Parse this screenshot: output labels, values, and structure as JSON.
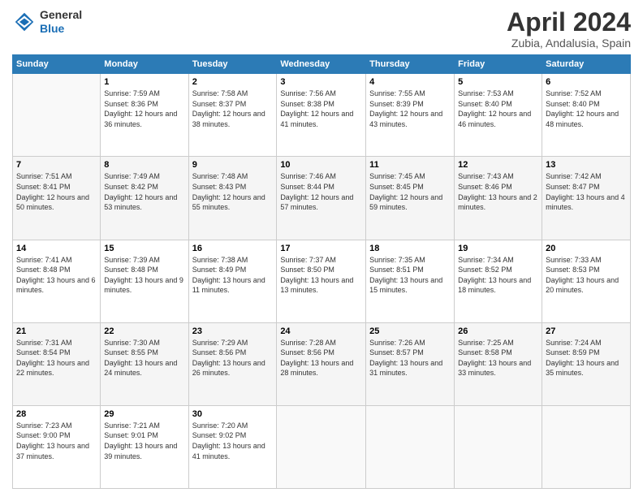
{
  "logo": {
    "line1": "General",
    "line2": "Blue"
  },
  "title": "April 2024",
  "subtitle": "Zubia, Andalusia, Spain",
  "days_header": [
    "Sunday",
    "Monday",
    "Tuesday",
    "Wednesday",
    "Thursday",
    "Friday",
    "Saturday"
  ],
  "weeks": [
    [
      {
        "day": "",
        "sunrise": "",
        "sunset": "",
        "daylight": ""
      },
      {
        "day": "1",
        "sunrise": "Sunrise: 7:59 AM",
        "sunset": "Sunset: 8:36 PM",
        "daylight": "Daylight: 12 hours and 36 minutes."
      },
      {
        "day": "2",
        "sunrise": "Sunrise: 7:58 AM",
        "sunset": "Sunset: 8:37 PM",
        "daylight": "Daylight: 12 hours and 38 minutes."
      },
      {
        "day": "3",
        "sunrise": "Sunrise: 7:56 AM",
        "sunset": "Sunset: 8:38 PM",
        "daylight": "Daylight: 12 hours and 41 minutes."
      },
      {
        "day": "4",
        "sunrise": "Sunrise: 7:55 AM",
        "sunset": "Sunset: 8:39 PM",
        "daylight": "Daylight: 12 hours and 43 minutes."
      },
      {
        "day": "5",
        "sunrise": "Sunrise: 7:53 AM",
        "sunset": "Sunset: 8:40 PM",
        "daylight": "Daylight: 12 hours and 46 minutes."
      },
      {
        "day": "6",
        "sunrise": "Sunrise: 7:52 AM",
        "sunset": "Sunset: 8:40 PM",
        "daylight": "Daylight: 12 hours and 48 minutes."
      }
    ],
    [
      {
        "day": "7",
        "sunrise": "Sunrise: 7:51 AM",
        "sunset": "Sunset: 8:41 PM",
        "daylight": "Daylight: 12 hours and 50 minutes."
      },
      {
        "day": "8",
        "sunrise": "Sunrise: 7:49 AM",
        "sunset": "Sunset: 8:42 PM",
        "daylight": "Daylight: 12 hours and 53 minutes."
      },
      {
        "day": "9",
        "sunrise": "Sunrise: 7:48 AM",
        "sunset": "Sunset: 8:43 PM",
        "daylight": "Daylight: 12 hours and 55 minutes."
      },
      {
        "day": "10",
        "sunrise": "Sunrise: 7:46 AM",
        "sunset": "Sunset: 8:44 PM",
        "daylight": "Daylight: 12 hours and 57 minutes."
      },
      {
        "day": "11",
        "sunrise": "Sunrise: 7:45 AM",
        "sunset": "Sunset: 8:45 PM",
        "daylight": "Daylight: 12 hours and 59 minutes."
      },
      {
        "day": "12",
        "sunrise": "Sunrise: 7:43 AM",
        "sunset": "Sunset: 8:46 PM",
        "daylight": "Daylight: 13 hours and 2 minutes."
      },
      {
        "day": "13",
        "sunrise": "Sunrise: 7:42 AM",
        "sunset": "Sunset: 8:47 PM",
        "daylight": "Daylight: 13 hours and 4 minutes."
      }
    ],
    [
      {
        "day": "14",
        "sunrise": "Sunrise: 7:41 AM",
        "sunset": "Sunset: 8:48 PM",
        "daylight": "Daylight: 13 hours and 6 minutes."
      },
      {
        "day": "15",
        "sunrise": "Sunrise: 7:39 AM",
        "sunset": "Sunset: 8:48 PM",
        "daylight": "Daylight: 13 hours and 9 minutes."
      },
      {
        "day": "16",
        "sunrise": "Sunrise: 7:38 AM",
        "sunset": "Sunset: 8:49 PM",
        "daylight": "Daylight: 13 hours and 11 minutes."
      },
      {
        "day": "17",
        "sunrise": "Sunrise: 7:37 AM",
        "sunset": "Sunset: 8:50 PM",
        "daylight": "Daylight: 13 hours and 13 minutes."
      },
      {
        "day": "18",
        "sunrise": "Sunrise: 7:35 AM",
        "sunset": "Sunset: 8:51 PM",
        "daylight": "Daylight: 13 hours and 15 minutes."
      },
      {
        "day": "19",
        "sunrise": "Sunrise: 7:34 AM",
        "sunset": "Sunset: 8:52 PM",
        "daylight": "Daylight: 13 hours and 18 minutes."
      },
      {
        "day": "20",
        "sunrise": "Sunrise: 7:33 AM",
        "sunset": "Sunset: 8:53 PM",
        "daylight": "Daylight: 13 hours and 20 minutes."
      }
    ],
    [
      {
        "day": "21",
        "sunrise": "Sunrise: 7:31 AM",
        "sunset": "Sunset: 8:54 PM",
        "daylight": "Daylight: 13 hours and 22 minutes."
      },
      {
        "day": "22",
        "sunrise": "Sunrise: 7:30 AM",
        "sunset": "Sunset: 8:55 PM",
        "daylight": "Daylight: 13 hours and 24 minutes."
      },
      {
        "day": "23",
        "sunrise": "Sunrise: 7:29 AM",
        "sunset": "Sunset: 8:56 PM",
        "daylight": "Daylight: 13 hours and 26 minutes."
      },
      {
        "day": "24",
        "sunrise": "Sunrise: 7:28 AM",
        "sunset": "Sunset: 8:56 PM",
        "daylight": "Daylight: 13 hours and 28 minutes."
      },
      {
        "day": "25",
        "sunrise": "Sunrise: 7:26 AM",
        "sunset": "Sunset: 8:57 PM",
        "daylight": "Daylight: 13 hours and 31 minutes."
      },
      {
        "day": "26",
        "sunrise": "Sunrise: 7:25 AM",
        "sunset": "Sunset: 8:58 PM",
        "daylight": "Daylight: 13 hours and 33 minutes."
      },
      {
        "day": "27",
        "sunrise": "Sunrise: 7:24 AM",
        "sunset": "Sunset: 8:59 PM",
        "daylight": "Daylight: 13 hours and 35 minutes."
      }
    ],
    [
      {
        "day": "28",
        "sunrise": "Sunrise: 7:23 AM",
        "sunset": "Sunset: 9:00 PM",
        "daylight": "Daylight: 13 hours and 37 minutes."
      },
      {
        "day": "29",
        "sunrise": "Sunrise: 7:21 AM",
        "sunset": "Sunset: 9:01 PM",
        "daylight": "Daylight: 13 hours and 39 minutes."
      },
      {
        "day": "30",
        "sunrise": "Sunrise: 7:20 AM",
        "sunset": "Sunset: 9:02 PM",
        "daylight": "Daylight: 13 hours and 41 minutes."
      },
      {
        "day": "",
        "sunrise": "",
        "sunset": "",
        "daylight": ""
      },
      {
        "day": "",
        "sunrise": "",
        "sunset": "",
        "daylight": ""
      },
      {
        "day": "",
        "sunrise": "",
        "sunset": "",
        "daylight": ""
      },
      {
        "day": "",
        "sunrise": "",
        "sunset": "",
        "daylight": ""
      }
    ]
  ]
}
